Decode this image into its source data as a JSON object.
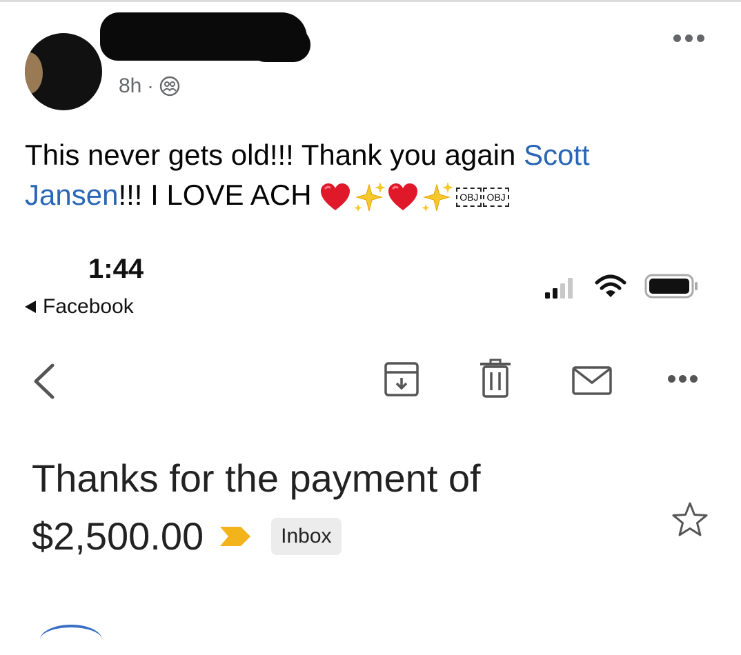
{
  "post": {
    "time": "8h",
    "separator": "·",
    "audience_icon": "friends-icon",
    "more_icon": "more-horizontal-icon",
    "text_before_mention": "This never gets old!!! Thank you again ",
    "mention": "Scott Jansen",
    "text_after_mention": "!!! I LOVE ACH ",
    "emojis": [
      "red-heart",
      "sparkles",
      "red-heart",
      "sparkles"
    ],
    "obj_placeholders": [
      "OBJ",
      "OBJ"
    ],
    "colors": {
      "mention": "#2a66b5",
      "meta": "#65676b"
    }
  },
  "phone_status": {
    "time": "1:44",
    "back_app": "Facebook",
    "icons": [
      "signal-icon",
      "wifi-icon",
      "battery-icon"
    ]
  },
  "gmail": {
    "toolbar_icons": [
      "back-arrow-icon",
      "archive-icon",
      "delete-icon",
      "mark-unread-icon",
      "more-icon"
    ],
    "subject_line1": "Thanks for the payment of",
    "subject_amount": "$2,500.00",
    "label_chip": "Inbox",
    "importance_color": "#f2b31b"
  }
}
